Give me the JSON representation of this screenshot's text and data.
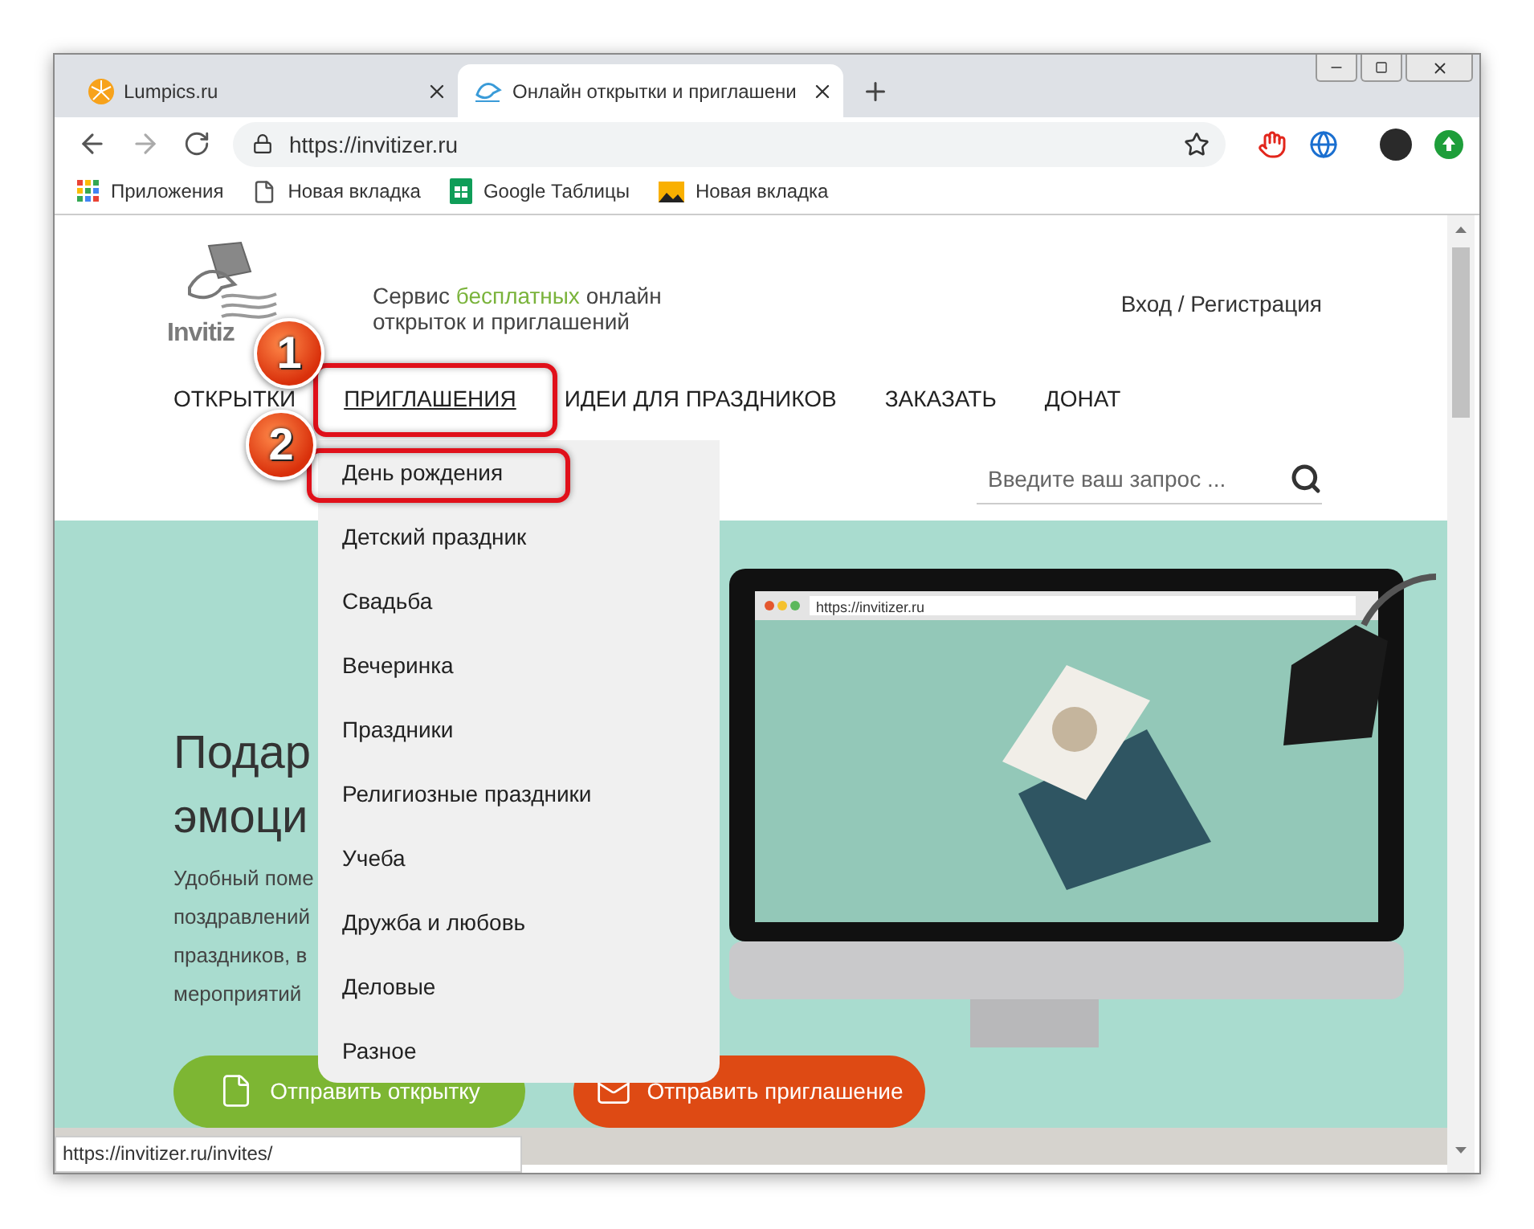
{
  "tabs": [
    {
      "title": "Lumpics.ru",
      "selected": false
    },
    {
      "title": "Онлайн открытки и приглашени",
      "selected": true
    }
  ],
  "address_bar": {
    "url": "https://invitizer.ru"
  },
  "bookmarks": [
    {
      "label": "Приложения",
      "kind": "apps"
    },
    {
      "label": "Новая вкладка",
      "kind": "page"
    },
    {
      "label": "Google Таблицы",
      "kind": "sheets"
    },
    {
      "label": "Новая вкладка",
      "kind": "image"
    }
  ],
  "site": {
    "logo_text": "Invitiz",
    "tagline": {
      "before": "Сервис ",
      "highlight": "бесплатных",
      "after": " онлайн открыток и приглашений"
    },
    "login": "Вход / Регистрация"
  },
  "nav": [
    {
      "label": "ОТКРЫТКИ",
      "selected": false
    },
    {
      "label": "ПРИГЛАШЕНИЯ",
      "selected": true
    },
    {
      "label": "ИДЕИ ДЛЯ ПРАЗДНИКОВ",
      "selected": false
    },
    {
      "label": "ЗАКАЗАТЬ",
      "selected": false
    },
    {
      "label": "ДОНАТ",
      "selected": false
    }
  ],
  "search": {
    "placeholder": "Введите ваш запрос ..."
  },
  "dropdown": [
    "День рождения",
    "Детский праздник",
    "Свадьба",
    "Вечеринка",
    "Праздники",
    "Религиозные праздники",
    "Учеба",
    "Дружба и любовь",
    "Деловые",
    "Разное"
  ],
  "hero": {
    "title_lines": [
      "Подар",
      "эмоци"
    ],
    "text_lines": [
      "Удобный поме",
      "поздравлений",
      "праздников, в",
      "мероприятий"
    ],
    "screen_url": "https://invitizer.ru",
    "buttons": [
      {
        "label": "Отправить открытку",
        "kind": "card"
      },
      {
        "label": "Отправить приглашение",
        "kind": "invite"
      }
    ]
  },
  "annotations": [
    {
      "number": "1"
    },
    {
      "number": "2"
    }
  ],
  "status_bar": {
    "url": "https://invitizer.ru/invites/"
  }
}
